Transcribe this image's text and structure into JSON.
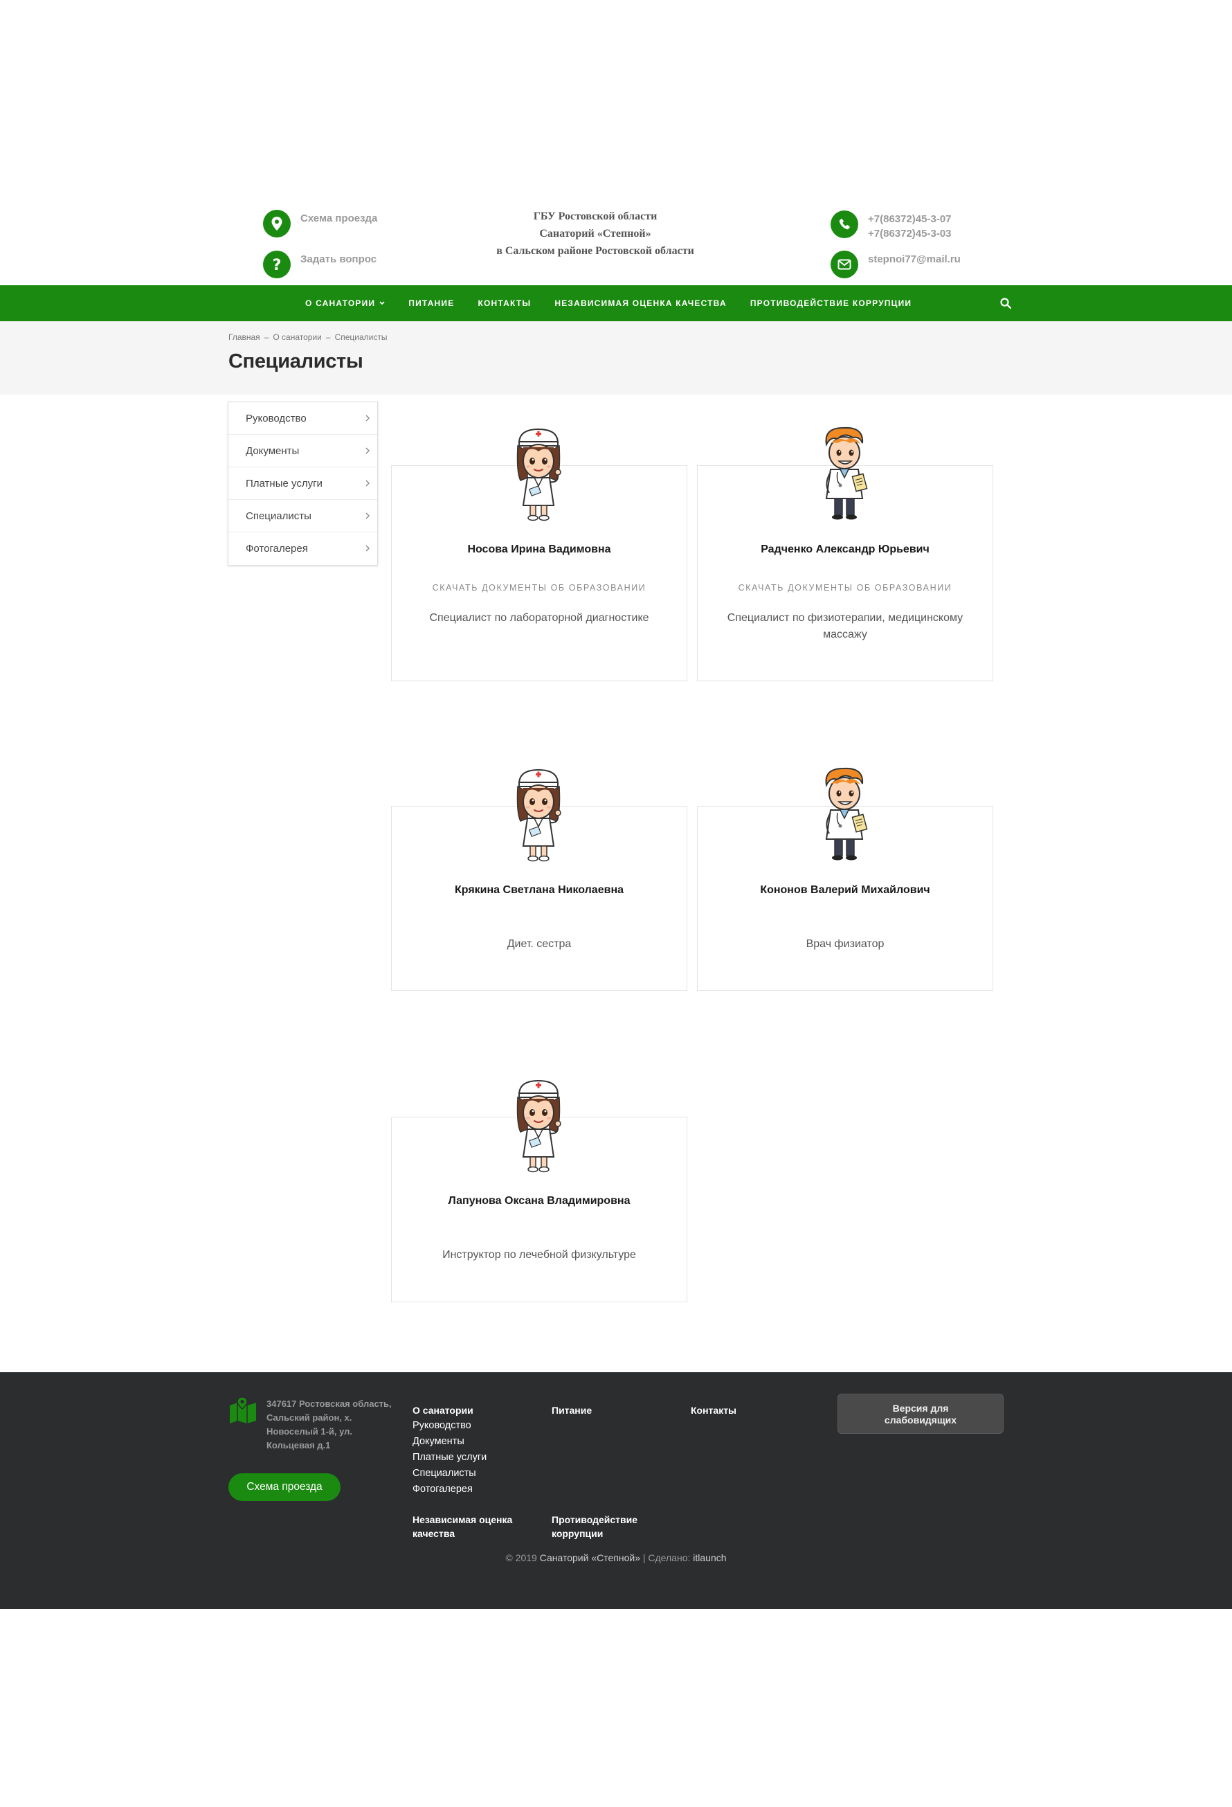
{
  "header": {
    "directions_link": "Схема проезда",
    "ask_link": "Задать вопрос",
    "org_line1": "ГБУ Ростовской области",
    "org_line2": "Санаторий «Степной»",
    "org_line3": "в Сальском районе Ростовской области",
    "phone1": "+7(86372)45-3-07",
    "phone2": "+7(86372)45-3-03",
    "email": "stepnoi77@mail.ru"
  },
  "nav": {
    "items": [
      "О САНАТОРИИ",
      "ПИТАНИЕ",
      "КОНТАКТЫ",
      "НЕЗАВИСИМАЯ ОЦЕНКА КАЧЕСТВА",
      "ПРОТИВОДЕЙСТВИЕ КОРРУПЦИИ"
    ],
    "search_icon": "search-icon"
  },
  "breadcrumb": [
    "Главная",
    "О санатории",
    "Специалисты"
  ],
  "breadcrumb_sep": "–",
  "page_title": "Специалисты",
  "sidebar": {
    "items": [
      "Руководство",
      "Документы",
      "Платные услуги",
      "Специалисты",
      "Фотогалерея"
    ]
  },
  "specialists": [
    {
      "name": "Носова Ирина Вадимовна",
      "docs": "СКАЧАТЬ ДОКУМЕНТЫ ОБ ОБРАЗОВАНИИ",
      "role": "Специалист по лабораторной диагностике",
      "avatar": "nurse-avatar"
    },
    {
      "name": "Радченко Александр Юрьевич",
      "docs": "СКАЧАТЬ ДОКУМЕНТЫ ОБ ОБРАЗОВАНИИ",
      "role": "Специалист по физиотерапии, медицинскому массажу",
      "avatar": "doctor-avatar"
    },
    {
      "name": "Крякина Светлана Николаевна",
      "docs": "",
      "role": "Диет. сестра",
      "avatar": "nurse-avatar"
    },
    {
      "name": "Кононов Валерий Михайлович",
      "docs": "",
      "role": "Врач физиатор",
      "avatar": "doctor-avatar"
    },
    {
      "name": "Лапунова Оксана Владимировна",
      "docs": "",
      "role": "Инструктор по лечебной физкультуре",
      "avatar": "nurse-avatar"
    }
  ],
  "footer": {
    "address": "347617 Ростовская область, Сальский район, х. Новоселый 1-й, ул. Кольцевая д.1",
    "directions_button": "Схема проезда",
    "col1_title": "О санатории",
    "col1_links": [
      "Руководство",
      "Документы",
      "Платные услуги",
      "Специалисты",
      "Фотогалерея"
    ],
    "col2_title": "Питание",
    "col3_title": "Контакты",
    "col4_title": "Независимая оценка качества",
    "col5_title": "Противодействие коррупции",
    "vision_button": "Версия для слабовидящих",
    "copyright_prefix": "© 2019",
    "copyright_brand": "Санаторий «Степной»",
    "copyright_made": "| Сделано:",
    "copyright_dev": "itlaunch"
  },
  "colors": {
    "brand_green": "#1a8b10",
    "footer_bg": "#2b2d2e",
    "title_band_bg": "#f5f5f5"
  }
}
